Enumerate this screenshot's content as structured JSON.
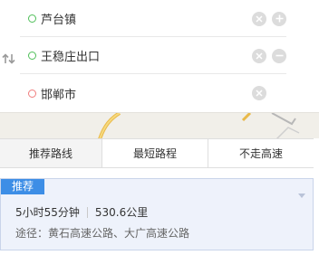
{
  "stops": [
    {
      "name": "芦台镇",
      "role": "start",
      "controls": [
        "clear",
        "add"
      ]
    },
    {
      "name": "王稳庄出口",
      "role": "via",
      "controls": [
        "clear",
        "remove"
      ]
    },
    {
      "name": "邯郸市",
      "role": "end",
      "controls": [
        "clear"
      ]
    }
  ],
  "tabs": [
    "推荐路线",
    "最短路程",
    "不走高速"
  ],
  "active_tab": "推荐路线",
  "route": {
    "badge": "推荐",
    "duration": "5小时55分钟",
    "distance": "530.6公里",
    "via_prefix": "途径：",
    "via_roads": "黄石高速公路、大广高速公路"
  },
  "colors": {
    "accent": "#3d8ee6",
    "start_dot": "#4fbf59",
    "end_dot": "#f07d7d",
    "card_bg": "#eef2fb"
  },
  "icons": [
    "swap-icon",
    "clear-icon",
    "add-icon",
    "remove-icon",
    "collapse-icon"
  ]
}
